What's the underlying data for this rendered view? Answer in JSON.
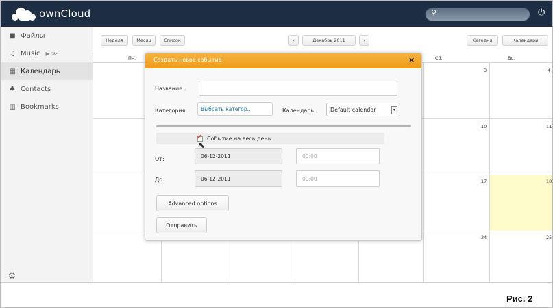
{
  "app": {
    "logo_text": "ownCloud",
    "search_placeholder": ""
  },
  "sidebar": {
    "items": [
      {
        "icon": "folder-icon",
        "label": "Файлы",
        "active": false
      },
      {
        "icon": "music-icon",
        "label": "Music",
        "extra": "▶ ≫",
        "active": false
      },
      {
        "icon": "calendar-icon",
        "label": "Календарь",
        "active": true
      },
      {
        "icon": "contacts-icon",
        "label": "Contacts",
        "active": false
      },
      {
        "icon": "bookmarks-icon",
        "label": "Bookmarks",
        "active": false
      }
    ]
  },
  "toolbar": {
    "week": "Неделя",
    "month": "Месяц",
    "list": "Список",
    "prev": "‹",
    "period": "Декабрь 2011",
    "next": "›",
    "today": "Сегодня",
    "calendars": "Календари"
  },
  "calendar": {
    "columns": [
      "Пн.",
      "",
      "",
      "",
      "",
      "Сб.",
      "Вс."
    ],
    "rows": [
      [
        "",
        "",
        "",
        "",
        "",
        "3",
        "4"
      ],
      [
        "",
        "",
        "",
        "",
        "",
        "10",
        "11"
      ],
      [
        "",
        "",
        "",
        "",
        "",
        "17",
        "18"
      ],
      [
        "",
        "",
        "",
        "",
        "",
        "24",
        "25"
      ]
    ],
    "highlight": {
      "row": 2,
      "col": 6
    },
    "highlight_color": "#fffccc"
  },
  "dialog": {
    "title": "Создать новое событие",
    "close": "×",
    "title_label": "Название:",
    "title_value": "",
    "category_label": "Категория:",
    "category_button": "Выбрать категор...",
    "calendar_label": "Календарь:",
    "calendar_value": "Default calendar",
    "allday_label": "Событие на весь день",
    "allday_checked": true,
    "from_label": "От:",
    "from_date": "06-12-2011",
    "from_time": "00:00",
    "to_label": "До:",
    "to_date": "06-12-2011",
    "to_time": "00:00",
    "advanced": "Advanced options",
    "submit": "Отправить"
  },
  "colors": {
    "header_bg": "#1d2d44",
    "dialog_title_bg": "#f0a227",
    "link": "#1d75b3"
  },
  "caption": "Рис. 2"
}
